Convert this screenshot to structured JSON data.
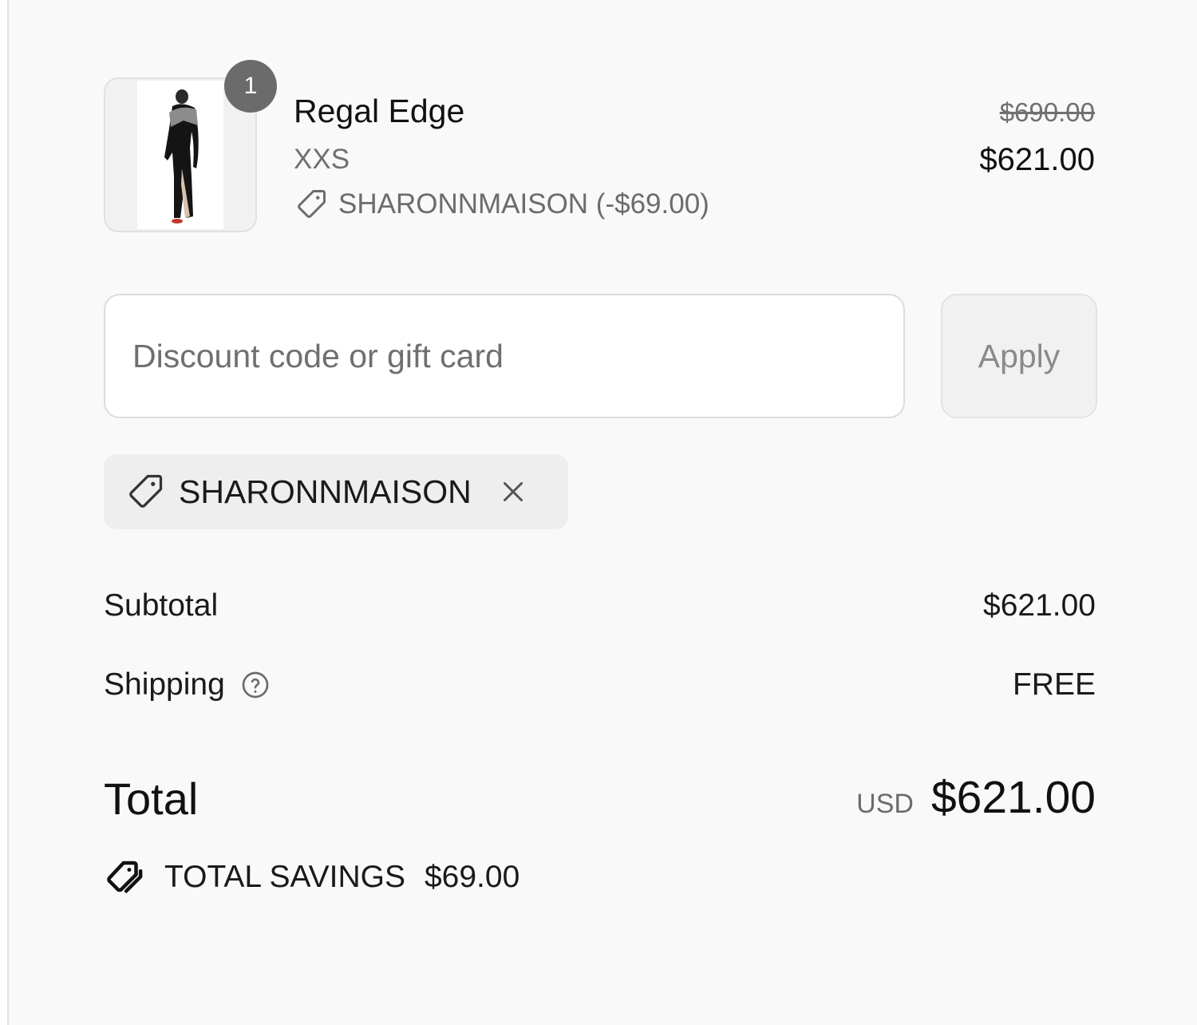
{
  "product": {
    "quantity": "1",
    "name": "Regal Edge",
    "variant": "XXS",
    "discount_line": "SHARONNMAISON (-$69.00)",
    "price_original": "$690.00",
    "price_current": "$621.00",
    "image_alt": "Regal Edge gown"
  },
  "discount": {
    "placeholder": "Discount code or gift card",
    "apply_label": "Apply",
    "applied_code": "SHARONNMAISON"
  },
  "summary": {
    "subtotal_label": "Subtotal",
    "subtotal_value": "$621.00",
    "shipping_label": "Shipping",
    "shipping_value": "FREE",
    "total_label": "Total",
    "total_currency": "USD",
    "total_value": "$621.00",
    "savings_label": "TOTAL SAVINGS",
    "savings_value": "$69.00"
  },
  "icons": {
    "tag": "tag-icon",
    "close": "close-icon",
    "help": "question-circle-icon",
    "savings": "tags-icon"
  },
  "colors": {
    "panel_background": "#f9f9f9",
    "badge": "#6b6b6b",
    "muted_text": "#707070"
  }
}
